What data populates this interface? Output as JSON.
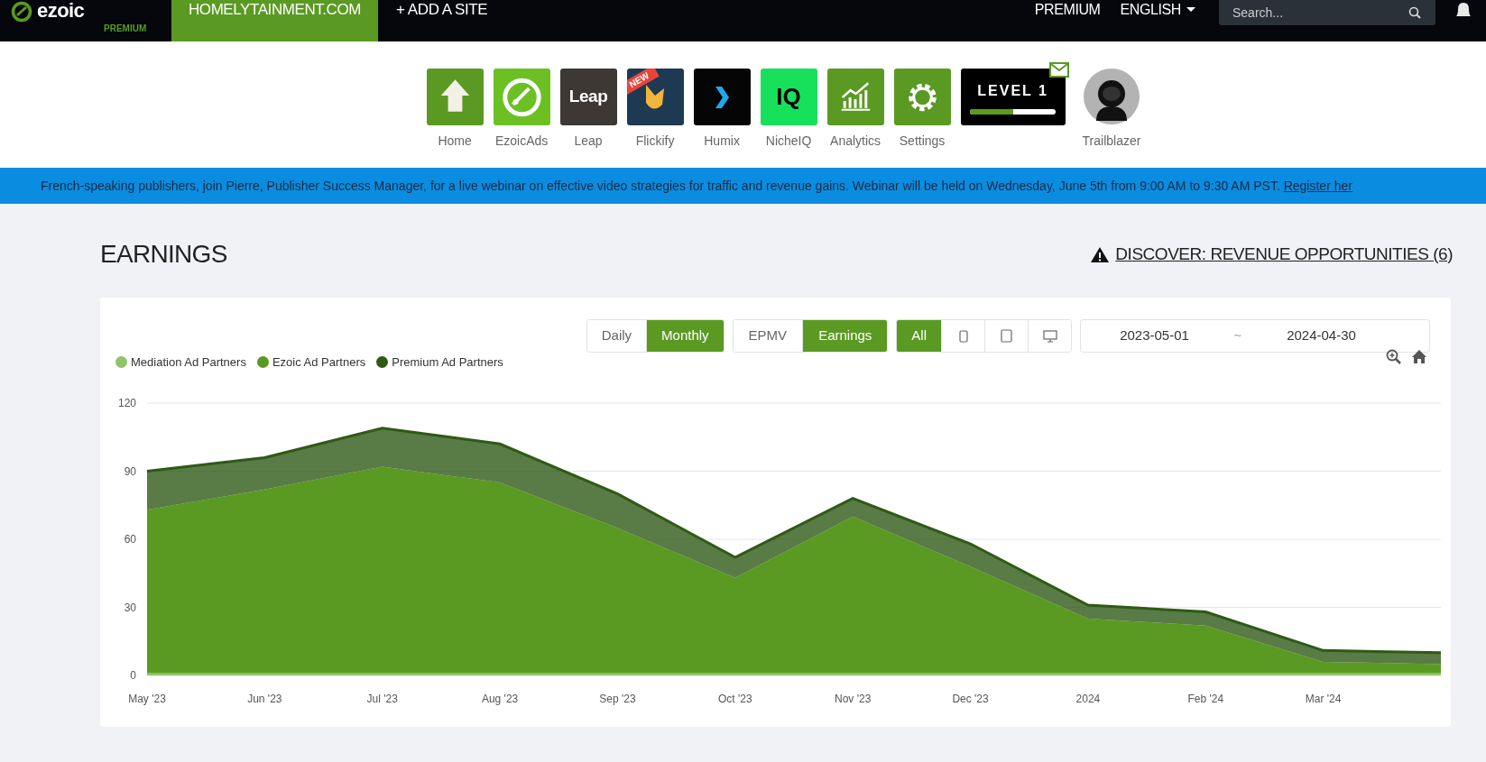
{
  "top_bar": {
    "logo": {
      "text": "ezoic",
      "sub": "PREMIUM"
    },
    "sites": [
      {
        "label": "HOMELYTAINMENT.COM",
        "selected": true
      },
      {
        "label": "+ ADD A SITE",
        "selected": false
      }
    ],
    "links": [
      {
        "kind": "plain",
        "label": "PREMIUM"
      },
      {
        "kind": "dropdown",
        "label": "ENGLISH"
      }
    ],
    "search": {
      "placeholder": "Search..."
    }
  },
  "apps": [
    {
      "kind": "home",
      "label": "Home"
    },
    {
      "kind": "ezoicads",
      "label": "EzoicAds"
    },
    {
      "kind": "leap",
      "label": "Leap",
      "icon_text": "Leap"
    },
    {
      "kind": "flickify",
      "label": "Flickify",
      "badge": "NEW"
    },
    {
      "kind": "humix",
      "label": "Humix"
    },
    {
      "kind": "nicheiq",
      "label": "NicheIQ",
      "icon_text": "IQ"
    },
    {
      "kind": "analytics",
      "label": "Analytics"
    },
    {
      "kind": "settings",
      "label": "Settings"
    },
    {
      "kind": "level",
      "title": "LEVEL 1",
      "level": 0.5
    },
    {
      "kind": "avatar",
      "label": "Trailblazer"
    }
  ],
  "banner": {
    "text": "French-speaking publishers, join Pierre, Publisher Success Manager, for a live webinar on effective video strategies for traffic and revenue gains. Webinar will be held on Wednesday, June 5th from 9:00 AM to 9:30 AM PST.",
    "link": "Register her"
  },
  "main": {
    "title": "EARNINGS",
    "discover": "DISCOVER: REVENUE OPPORTUNITIES (6)",
    "period": [
      {
        "label": "Daily",
        "selected": false
      },
      {
        "label": "Monthly",
        "selected": true
      }
    ],
    "metric": [
      {
        "label": "EPMV",
        "selected": false
      },
      {
        "label": "Earnings",
        "selected": true
      }
    ],
    "devices": [
      {
        "kind": "all",
        "label": "All",
        "selected": true
      },
      {
        "kind": "phone",
        "selected": false
      },
      {
        "kind": "tablet",
        "selected": false
      },
      {
        "kind": "desktop",
        "selected": false
      }
    ],
    "date_range": {
      "start": "2023-05-01",
      "separator": "~",
      "end": "2024-04-30"
    },
    "chart_data": {
      "type": "area",
      "stacked": true,
      "grid": true,
      "categories": [
        "May '23",
        "Jun '23",
        "Jul '23",
        "Aug '23",
        "Sep '23",
        "Oct '23",
        "Nov '23",
        "Dec '23",
        "2024",
        "Feb '24",
        "Mar '24",
        null
      ],
      "ylim": [
        0,
        120
      ],
      "yticks": [
        0,
        30,
        60,
        90,
        120
      ],
      "series": [
        {
          "name": "Mediation Ad Partners",
          "color": "#8fc46a",
          "values": [
            1,
            1,
            1,
            1,
            1,
            1,
            1,
            1,
            1,
            1,
            1,
            1
          ]
        },
        {
          "name": "Ezoic Ad Partners",
          "color": "#5a9a22",
          "values": [
            72,
            81,
            91,
            84,
            64,
            42,
            69,
            47,
            24,
            21,
            5,
            4
          ]
        },
        {
          "name": "Premium Ad Partners",
          "color": "#2f5a16",
          "values": [
            17,
            14,
            17,
            17,
            15,
            9,
            8,
            10,
            6,
            6,
            5,
            5
          ]
        }
      ]
    }
  }
}
